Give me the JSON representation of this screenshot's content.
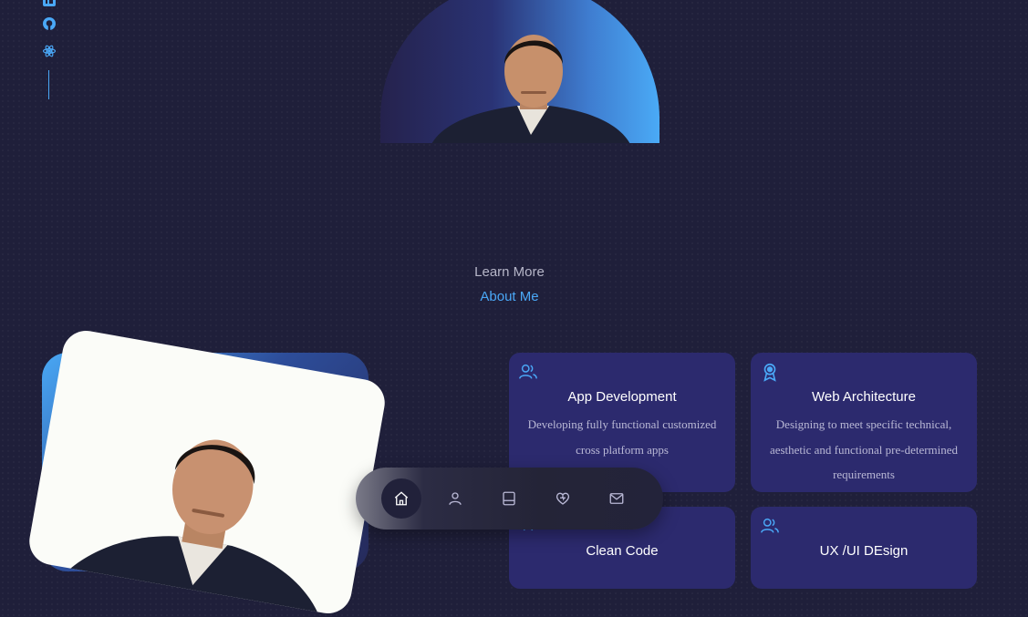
{
  "social": {
    "icons": [
      "linkedin-icon",
      "github-icon",
      "react-icon"
    ],
    "accent": "#4aa8f7"
  },
  "about": {
    "subtitle": "Learn More",
    "title": "About Me"
  },
  "services": [
    {
      "icon": "users-icon",
      "title": "App Development",
      "description": "Developing fully functional customized cross platform apps"
    },
    {
      "icon": "award-icon",
      "title": "Web Architecture",
      "description": "Designing to meet specific technical, aesthetic and functional pre-determined requirements"
    },
    {
      "icon": "code-icon",
      "title": "Clean Code",
      "description": ""
    },
    {
      "icon": "users-icon",
      "title": "UX /UI DEsign",
      "description": ""
    }
  ],
  "nav": {
    "items": [
      "home-icon",
      "user-icon",
      "book-icon",
      "heart-icon",
      "mail-icon"
    ],
    "active": "home-icon"
  },
  "colors": {
    "background": "#1f1f3a",
    "card": "#2c2a6e",
    "accent": "#4aa8f7"
  }
}
